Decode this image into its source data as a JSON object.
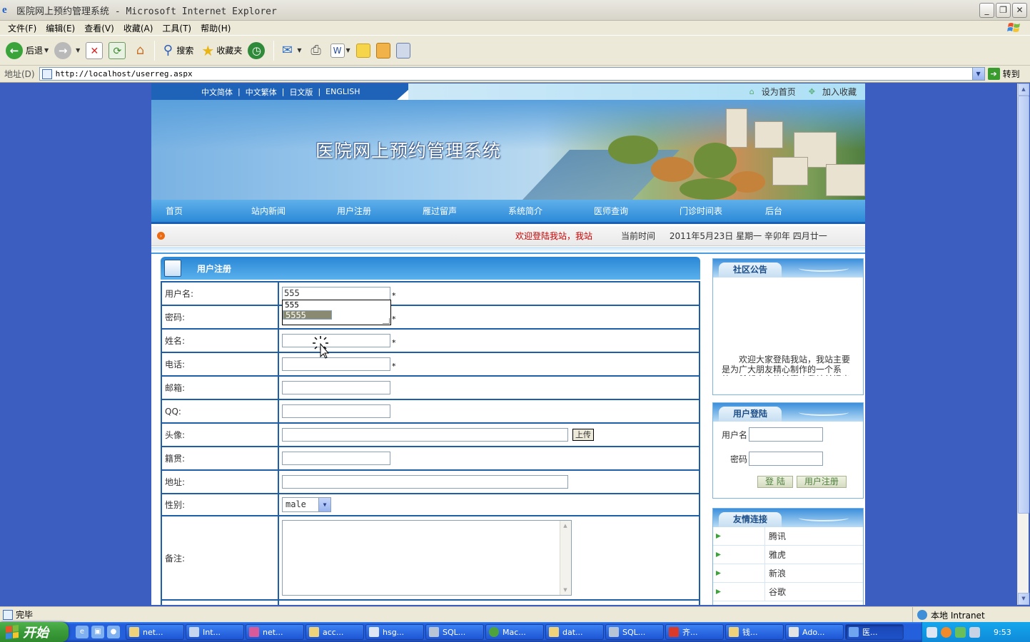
{
  "window": {
    "title": "医院网上预约管理系统 - Microsoft Internet Explorer",
    "buttons": [
      "minimize",
      "restore",
      "close"
    ]
  },
  "menu": {
    "items": [
      "文件(F)",
      "编辑(E)",
      "查看(V)",
      "收藏(A)",
      "工具(T)",
      "帮助(H)"
    ]
  },
  "toolbar": {
    "back_label": "后退",
    "search_label": "搜索",
    "favorites_label": "收藏夹"
  },
  "address": {
    "label": "地址(D)",
    "url": "http://localhost/userreg.aspx",
    "go_label": "转到"
  },
  "site": {
    "languages": [
      "中文简体",
      "中文繁体",
      "日文版",
      "ENGLISH"
    ],
    "set_home": "设为首页",
    "add_favorite": "加入收藏",
    "banner_title": "医院网上预约管理系统",
    "nav": [
      "首页",
      "站内新闻",
      "用户注册",
      "雁过留声",
      "系统简介",
      "医师查询",
      "门诊时间表",
      "后台"
    ],
    "welcome": "欢迎登陆我站，我站",
    "time_label": "当前时间",
    "date_text": "2011年5月23日  星期一  辛卯年  四月廿一"
  },
  "register": {
    "title": "用户注册",
    "fields": {
      "username": {
        "label": "用户名:",
        "value": "555"
      },
      "password": {
        "label": "密码:",
        "value": ""
      },
      "name": {
        "label": "姓名:",
        "value": ""
      },
      "phone": {
        "label": "电话:",
        "value": ""
      },
      "email": {
        "label": "邮箱:",
        "value": ""
      },
      "qq": {
        "label": "QQ:",
        "value": ""
      },
      "avatar": {
        "label": "头像:",
        "value": "",
        "button": "上传"
      },
      "hometown": {
        "label": "籍贯:",
        "value": ""
      },
      "address": {
        "label": "地址:",
        "value": ""
      },
      "gender": {
        "label": "性别:",
        "value": "male"
      },
      "remark": {
        "label": "备注:",
        "value": ""
      }
    },
    "required_mark": "*",
    "autocomplete": [
      "555",
      "5555"
    ],
    "autocomplete_selected": "5555"
  },
  "notice": {
    "title": "社区公告",
    "text": "欢迎大家登陆我站，我站主要是为广大朋友精心制作的一个系统，希望大家能够喜欢我站并提出宝贵意见"
  },
  "login": {
    "title": "用户登陆",
    "username_label": "用户名",
    "password_label": "密码",
    "login_button": "登 陆",
    "register_button": "用户注册"
  },
  "links": {
    "title": "友情连接",
    "items": [
      "腾讯",
      "雅虎",
      "新浪",
      "谷歌"
    ]
  },
  "status": {
    "text": "完毕",
    "zone": "本地 Intranet"
  },
  "taskbar": {
    "start": "开始",
    "tasks": [
      "net...",
      "Int...",
      "net...",
      "acc...",
      "hsg...",
      "SQL...",
      "Mac...",
      "dat...",
      "SQL...",
      "齐...",
      "钱...",
      "Ado...",
      "医..."
    ],
    "clock": "9:53"
  },
  "colors": {
    "page_bg": "#3c5ec1",
    "nav_blue": "#2d8ad8",
    "table_border": "#1e5fa8",
    "welcome_red": "#cc0000"
  }
}
